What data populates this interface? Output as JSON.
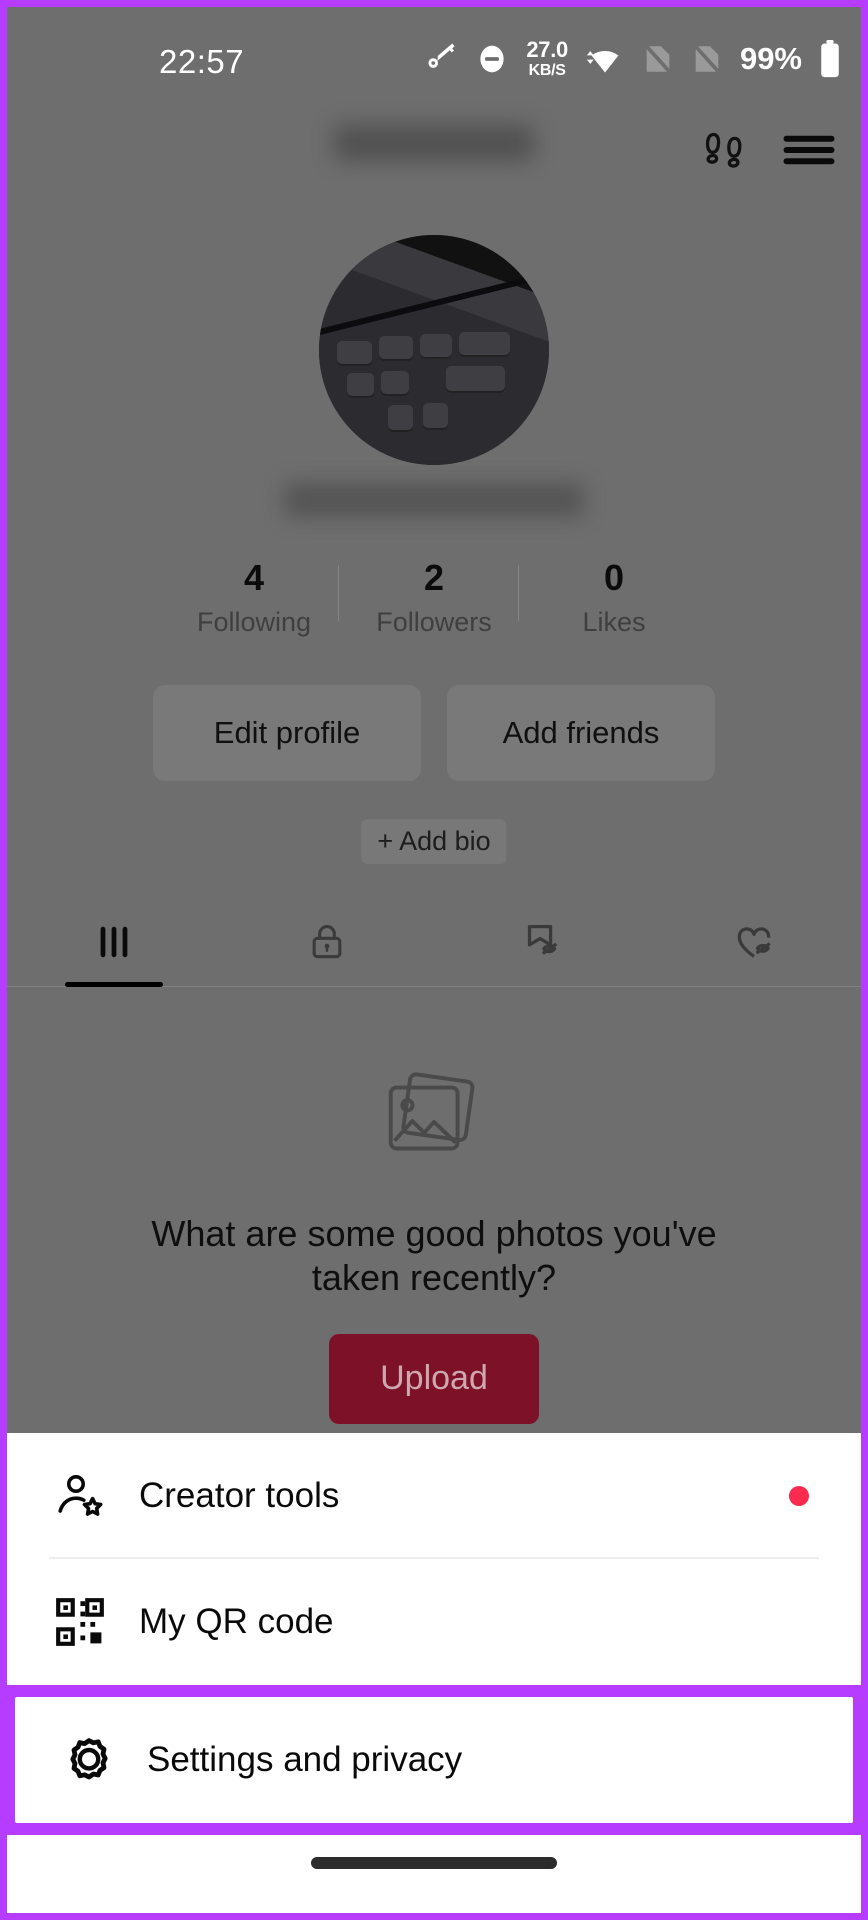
{
  "status_bar": {
    "time": "22:57",
    "network_speed_value": "27.0",
    "network_speed_unit": "KB/S",
    "battery_percent": "99%",
    "icons": [
      "vpn-key-icon",
      "do-not-disturb-icon",
      "network-speed-indicator",
      "wifi-icon",
      "sim-card-off-icon-1",
      "sim-card-off-icon-2",
      "battery-icon"
    ]
  },
  "top_bar": {
    "username": "",
    "footprints_icon": "footprints-icon",
    "menu_icon": "hamburger-menu-icon"
  },
  "profile": {
    "display_name": "",
    "stats": [
      {
        "count": "4",
        "label": "Following"
      },
      {
        "count": "2",
        "label": "Followers"
      },
      {
        "count": "0",
        "label": "Likes"
      }
    ],
    "edit_profile_label": "Edit profile",
    "add_friends_label": "Add friends",
    "add_bio_label": "+ Add bio"
  },
  "tabs": [
    {
      "name": "tab-videos",
      "icon": "grid-posts-icon",
      "active": true
    },
    {
      "name": "tab-private",
      "icon": "lock-icon",
      "active": false
    },
    {
      "name": "tab-saved",
      "icon": "bookmark-hidden-icon",
      "active": false
    },
    {
      "name": "tab-liked",
      "icon": "heart-hidden-icon",
      "active": false
    }
  ],
  "empty_state": {
    "icon": "photos-stack-icon",
    "message": "What are some good photos you've taken recently?",
    "upload_label": "Upload"
  },
  "bottom_sheet": {
    "items": [
      {
        "label": "Creator tools",
        "icon": "person-star-icon",
        "badge": true
      },
      {
        "label": "My QR code",
        "icon": "qr-code-icon",
        "badge": false
      },
      {
        "label": "Settings and privacy",
        "icon": "gear-icon",
        "badge": false,
        "highlighted": true
      }
    ]
  },
  "colors": {
    "highlight_purple": "#b63cff",
    "badge_red": "#fa2b4f",
    "upload_button": "#7d1128",
    "scrim": "#6e6e6e"
  }
}
